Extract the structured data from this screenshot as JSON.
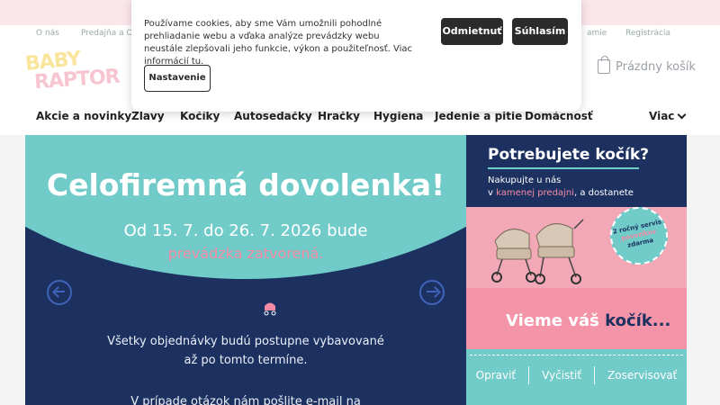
{
  "topbar": {
    "links": [
      "O nás",
      "Predajňa a O",
      "amie",
      "Registrácia"
    ]
  },
  "header": {
    "cart_label": "Prázdny košík"
  },
  "nav": {
    "items": [
      "Akcie a novinky",
      "Zlavy",
      "Kočíky",
      "Autosedačky",
      "Hračky",
      "Hygiena",
      "Jedenie a pitie",
      "Domácnosť"
    ],
    "more_label": "Viac"
  },
  "hero": {
    "title": "Celofiremná dovolenka!",
    "date_line": "Od 15. 7. do 26. 7. 2026 bude",
    "closed_line": "prevádzka zatvorená.",
    "body_line1": "Všetky objednávky budú postupne vybavované",
    "body_line2": "až po tomto termíne.",
    "body_line3": "V prípade otázok nám pošlite e-mail na"
  },
  "side_banner": {
    "heading": "Potrebujete kočík?",
    "text_line1": "Nakupujte u nás",
    "text_line2_prefix": "v",
    "text_line2_highlight": "kamenej predajni",
    "text_line2_suffix": ", a dostanete",
    "badge_line1": "2 ročný servis",
    "badge_line2": "povozíkov",
    "badge_line3": "zdarma",
    "vieme_prefix": "Vieme váš",
    "vieme_accent": "kočík...",
    "actions": [
      "Opraviť",
      "Vyčistiť",
      "Zoservisovať"
    ]
  },
  "cookie": {
    "text": "Používame cookies, aby sme Vám umožnili pohodlné prehliadanie webu a vďaka analýze prevádzky webu neustále zlepšovali jeho funkcie, výkon a použiteľnosť. Viac informácií",
    "link": "tu",
    "reject_label": "Odmietnuť",
    "accept_label": "Súhlasím",
    "settings_label": "Nastavenie"
  },
  "colors": {
    "navy": "#1d3160",
    "teal": "#71cbc9",
    "pink": "#f38aa3"
  }
}
